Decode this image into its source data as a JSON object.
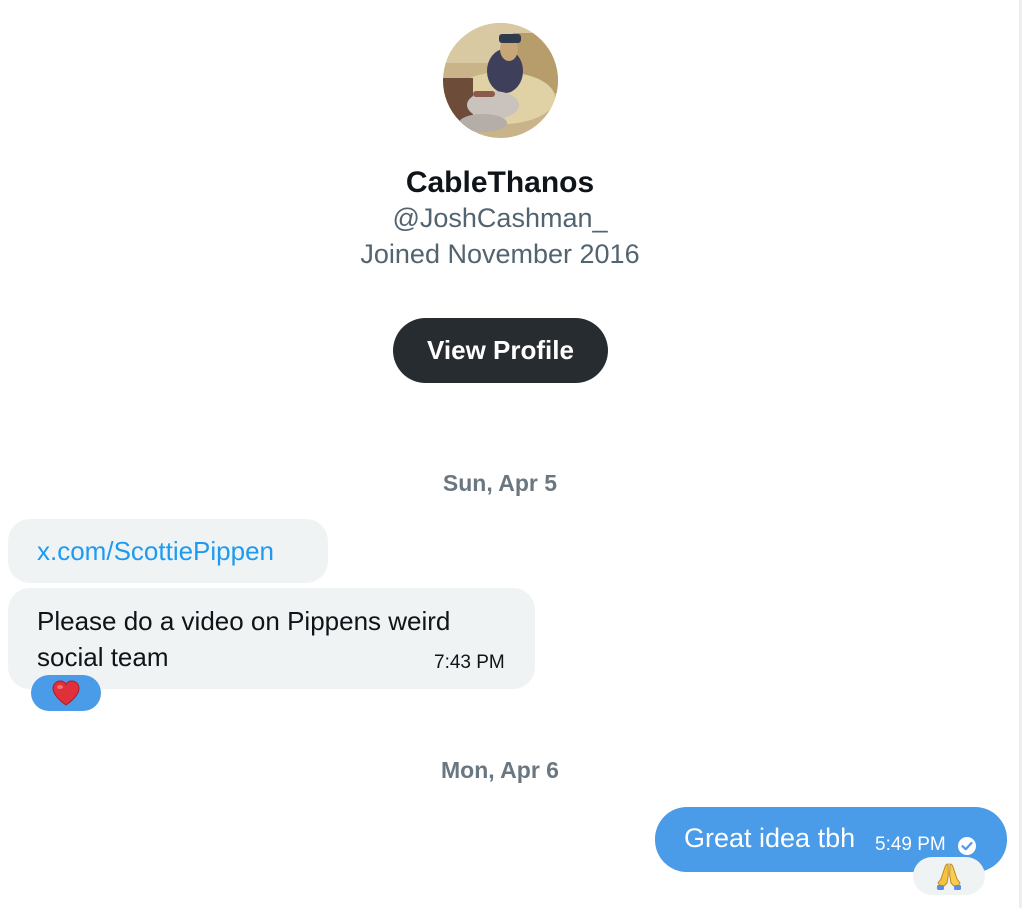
{
  "profile": {
    "display_name": "CableThanos",
    "handle": "@JoshCashman_",
    "joined": "Joined November 2016",
    "view_profile_label": "View Profile",
    "avatar_icon": "avatar-photo"
  },
  "conversation": [
    {
      "date": "Sun, Apr 5",
      "messages": [
        {
          "direction": "incoming",
          "link": "x.com/ScottiePippen"
        },
        {
          "direction": "incoming",
          "text": "Please do a video on Pippens weird social team",
          "time": "7:43 PM",
          "reaction": "heart-icon"
        }
      ]
    },
    {
      "date": "Mon, Apr 6",
      "messages": [
        {
          "direction": "outgoing",
          "text": "Great idea tbh",
          "time": "5:49 PM",
          "status_icon": "check-circle-icon",
          "reaction": "praying-hands-icon"
        }
      ]
    }
  ],
  "colors": {
    "outgoing_bubble": "#4a9be8",
    "incoming_bubble": "#eff3f4",
    "link": "#1d9bf0",
    "button_bg": "#272c30",
    "secondary_text": "#536471"
  }
}
